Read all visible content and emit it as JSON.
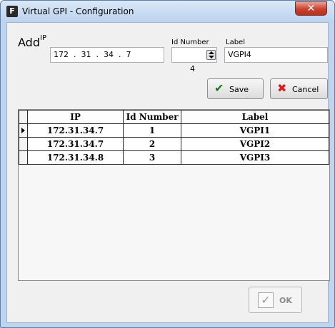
{
  "window": {
    "title": "Virtual GPI - Configuration",
    "app_icon_letter": "F"
  },
  "add_section": {
    "heading": "Add",
    "ip_label": "IP",
    "ip_value": "172  .  31  .  34  .  7",
    "id_label": "Id Number",
    "id_value": "4",
    "label_label": "Label",
    "label_value": "VGPI4"
  },
  "buttons": {
    "save": "Save",
    "cancel": "Cancel",
    "ok": "OK"
  },
  "colors": {
    "save_check": "#1a7a1a",
    "cancel_x": "#d42020"
  },
  "table": {
    "columns": [
      "IP",
      "Id Number",
      "Label"
    ],
    "rows": [
      {
        "ip": "172.31.34.7",
        "id": "1",
        "label": "VGPI1"
      },
      {
        "ip": "172.31.34.7",
        "id": "2",
        "label": "VGPI2"
      },
      {
        "ip": "172.31.34.8",
        "id": "3",
        "label": "VGPI3"
      }
    ]
  }
}
